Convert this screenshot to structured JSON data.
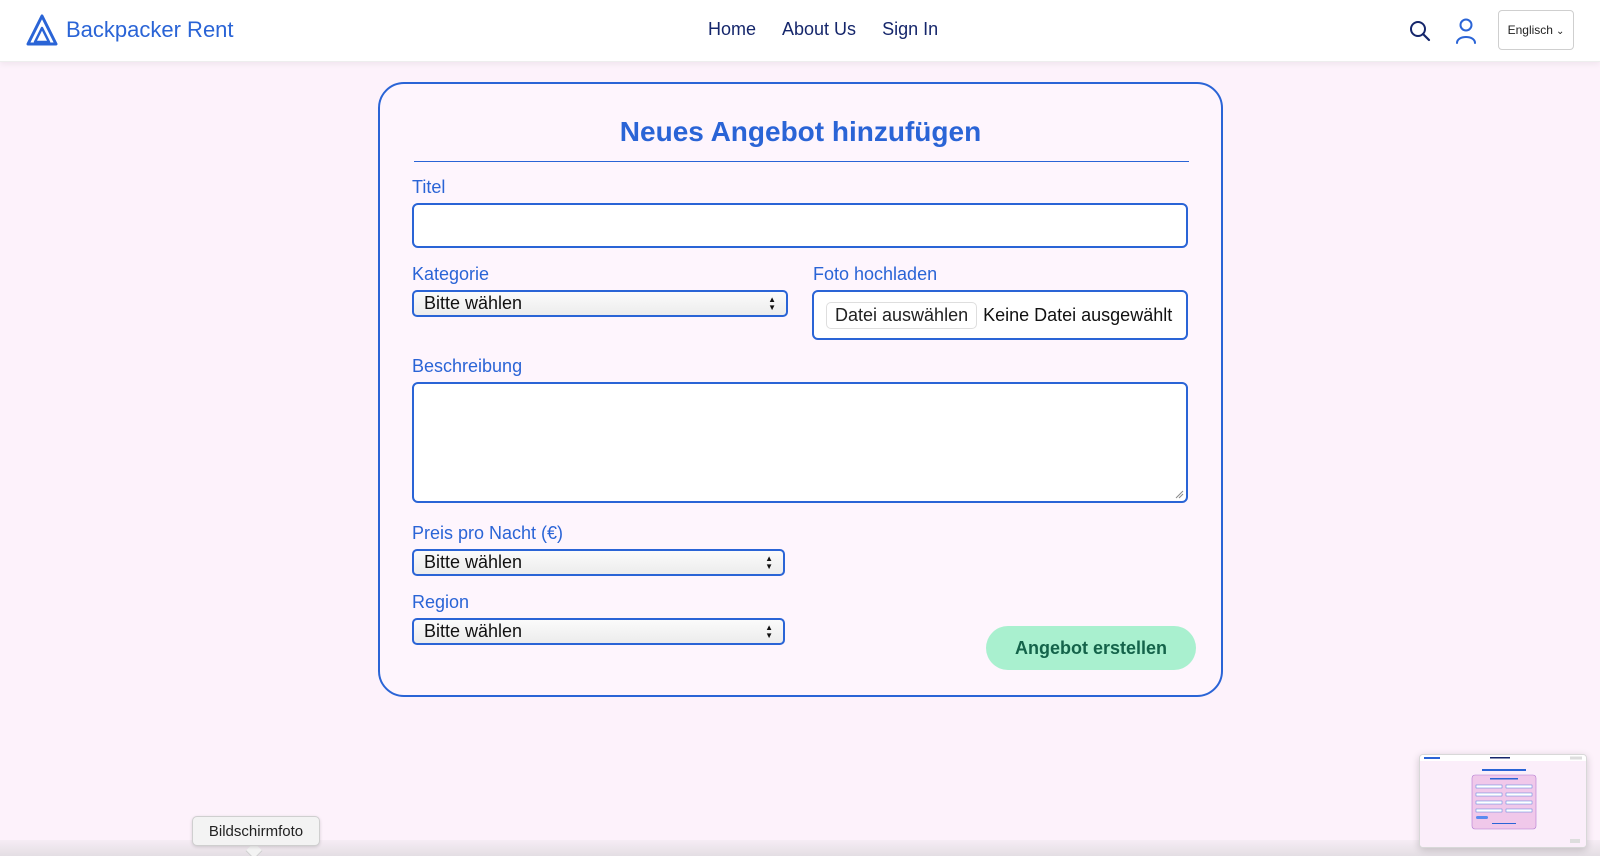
{
  "header": {
    "brand": "Backpacker Rent",
    "nav": [
      "Home",
      "About Us",
      "Sign In"
    ],
    "language": "Englisch",
    "icons": {
      "logo": "mountain-logo-icon",
      "search": "search-icon",
      "user": "user-icon",
      "language_caret": "chevron-down-icon"
    }
  },
  "form": {
    "title": "Neues Angebot hinzufügen",
    "title_label": "Titel",
    "title_value": "",
    "category_label": "Kategorie",
    "category_value": "Bitte wählen",
    "photo_label": "Foto hochladen",
    "photo_button": "Datei auswählen",
    "photo_status": "Keine Datei ausgewählt",
    "description_label": "Beschreibung",
    "description_value": "",
    "price_label": "Preis pro Nacht (€)",
    "price_value": "Bitte wählen",
    "region_label": "Region",
    "region_value": "Bitte wählen",
    "submit": "Angebot erstellen"
  },
  "overlay": {
    "tooltip": "Bildschirmfoto"
  },
  "colors": {
    "accent": "#2a64d6",
    "background": "#fdf2fb",
    "submit": "#a9f0cf",
    "nav_text": "#15266b"
  }
}
